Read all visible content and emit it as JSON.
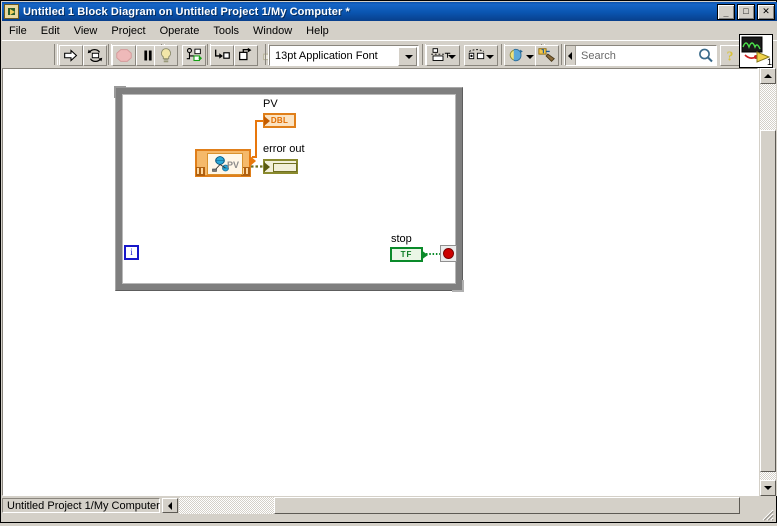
{
  "window": {
    "title": "Untitled 1 Block Diagram on Untitled Project 1/My Computer *",
    "app_icon": "labview-vi-icon",
    "controls": {
      "minimize": "_",
      "maximize": "□",
      "close": "✕"
    }
  },
  "menu": {
    "items": [
      {
        "label": "File"
      },
      {
        "label": "Edit"
      },
      {
        "label": "View"
      },
      {
        "label": "Project"
      },
      {
        "label": "Operate"
      },
      {
        "label": "Tools"
      },
      {
        "label": "Window"
      },
      {
        "label": "Help"
      }
    ]
  },
  "toolbar": {
    "buttons": [
      {
        "name": "run-button",
        "icon": "right-arrow-icon",
        "enabled": true
      },
      {
        "name": "run-continuously-button",
        "icon": "circular-arrows-icon",
        "enabled": true
      },
      {
        "name": "abort-execution-button",
        "icon": "stop-octagon-icon",
        "enabled": false
      },
      {
        "name": "pause-button",
        "icon": "pause-bars-icon",
        "enabled": true
      },
      {
        "name": "highlight-execution-button",
        "icon": "lightbulb-icon",
        "enabled": true
      },
      {
        "name": "retain-wire-values-button",
        "icon": "retain-wire-values-icon",
        "enabled": true
      },
      {
        "name": "step-into-button",
        "icon": "step-into-icon",
        "enabled": true
      },
      {
        "name": "step-over-button",
        "icon": "step-over-icon",
        "enabled": true
      },
      {
        "name": "step-out-button",
        "icon": "step-out-icon",
        "enabled": false
      }
    ],
    "font_combo": {
      "value": "13pt Application Font",
      "dropdown_icon": "chevron-down-icon"
    },
    "align_objects": {
      "icon": "align-objects-icon",
      "dropdown_icon": "chevron-down-icon"
    },
    "distribute_objects": {
      "icon": "distribute-objects-icon",
      "dropdown_icon": "chevron-down-icon"
    },
    "reorder": {
      "icon": "reorder-icon",
      "dropdown_icon": "chevron-down-icon"
    },
    "clean_up_diagram": {
      "icon": "clean-up-diagram-icon"
    },
    "help_button": {
      "icon": "question-mark-icon",
      "label": "?"
    },
    "vi_icon": {
      "icon": "vi-icon",
      "badge": "1"
    }
  },
  "search": {
    "placeholder": "Search",
    "value": "",
    "magnifier_icon": "magnifier-icon",
    "expand_icon": "expand-right-icon"
  },
  "diagram": {
    "while_loop": {
      "name": "while-loop",
      "iteration_terminal": {
        "label": "i"
      },
      "nodes": [
        {
          "name": "pv-subvi",
          "label": "PV",
          "icon": "network-globe-icon"
        }
      ],
      "indicators": [
        {
          "name": "pv-indicator",
          "label": "PV",
          "datatype": "DBL",
          "color": "#e07f1a"
        },
        {
          "name": "error-out-indicator",
          "label": "error out",
          "datatype": "cluster",
          "color": "#8a8a2e"
        }
      ],
      "controls": [
        {
          "name": "stop-control",
          "label": "stop",
          "datatype": "TF",
          "color": "#0a8a2a"
        }
      ],
      "stop_condition_terminal": {
        "name": "stop-condition-terminal",
        "icon": "stop-sign-icon"
      }
    }
  },
  "statusbar": {
    "target": "Untitled Project 1/My Computer",
    "collapse_icon": "left-arrow-icon"
  },
  "scrollbars": {
    "vertical": {
      "up_icon": "up-arrow-icon",
      "down_icon": "down-arrow-icon"
    },
    "horizontal": {
      "left_icon": "left-arrow-icon",
      "right_icon": "right-arrow-icon"
    }
  },
  "colors": {
    "titlebar": "#0b4fa8",
    "chrome": "#d4d0c8",
    "canvas": "#ffffff",
    "orange_wire": "#e8770c",
    "error_wire": "#8a8a2e",
    "bool_green": "#0a8a2a",
    "iteration_blue": "#1717c9",
    "stop_red": "#cc0000"
  }
}
